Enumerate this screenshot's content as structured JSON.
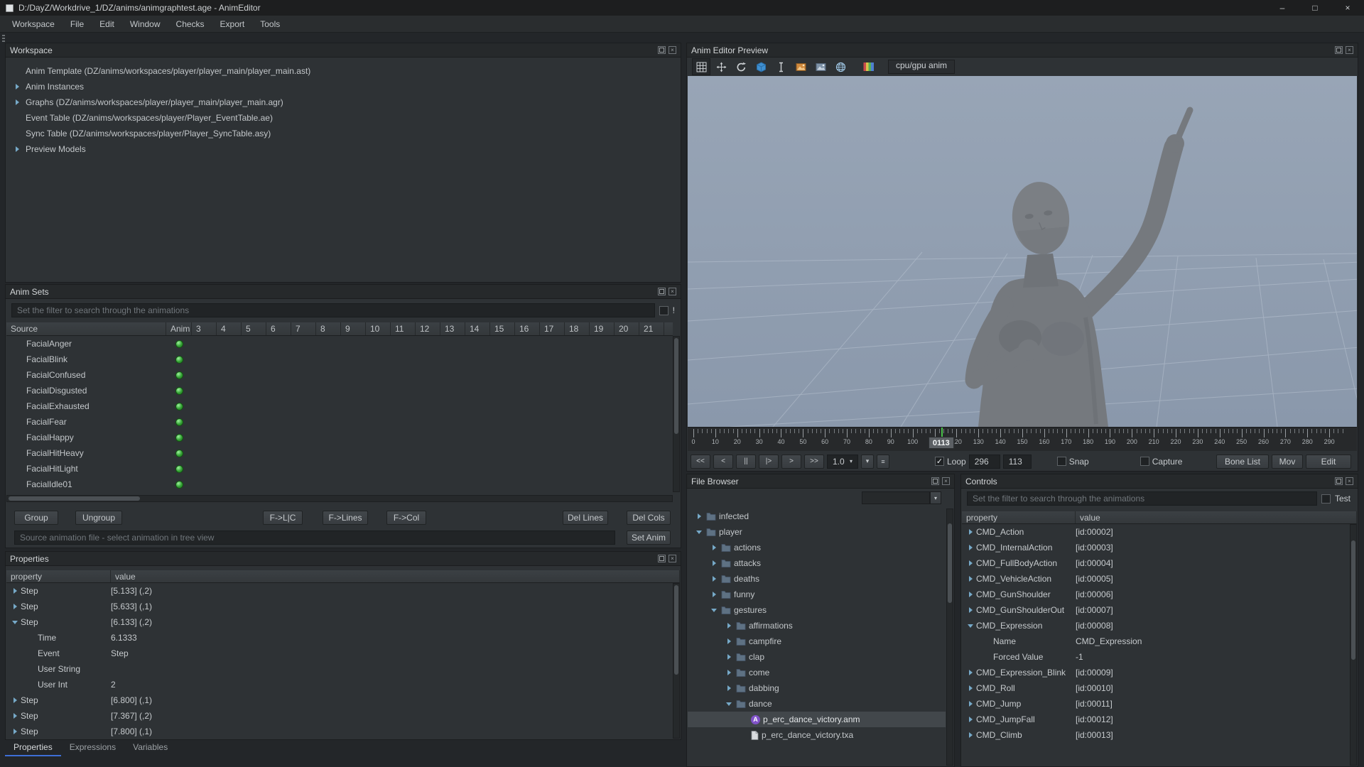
{
  "colors": {
    "accent_green": "#33a033",
    "tab_accent": "#3e6fd6",
    "viewport_top": "#98a5b6",
    "viewport_bottom": "#8a98ab",
    "anm_icon_purple": "#8052c8"
  },
  "window": {
    "title": "D:/DayZ/Workdrive_1/DZ/anims/animgraphtest.age - AnimEditor",
    "controls": {
      "minimize": "–",
      "maximize": "□",
      "close": "×"
    }
  },
  "menu": {
    "items": [
      "Workspace",
      "File",
      "Edit",
      "Window",
      "Checks",
      "Export",
      "Tools"
    ]
  },
  "workspace": {
    "title": "Workspace",
    "items": [
      {
        "label": "Anim Template (DZ/anims/workspaces/player/player_main/player_main.ast)",
        "arrow": ""
      },
      {
        "label": "Anim Instances",
        "arrow": "collapsed"
      },
      {
        "label": "Graphs (DZ/anims/workspaces/player/player_main/player_main.agr)",
        "arrow": "collapsed"
      },
      {
        "label": "Event Table (DZ/anims/workspaces/player/Player_EventTable.ae)",
        "arrow": ""
      },
      {
        "label": "Sync Table (DZ/anims/workspaces/player/Player_SyncTable.asy)",
        "arrow": ""
      },
      {
        "label": "Preview Models",
        "arrow": "collapsed"
      }
    ]
  },
  "anim_sets": {
    "title": "Anim Sets",
    "filter_placeholder": "Set the filter to search through the animations",
    "filter_negate_label": "!",
    "columns": [
      "Source",
      "Anim",
      "3",
      "4",
      "5",
      "6",
      "7",
      "8",
      "9",
      "10",
      "11",
      "12",
      "13",
      "14",
      "15",
      "16",
      "17",
      "18",
      "19",
      "20",
      "21"
    ],
    "rows": [
      "FacialAnger",
      "FacialBlink",
      "FacialConfused",
      "FacialDisgusted",
      "FacialExhausted",
      "FacialFear",
      "FacialHappy",
      "FacialHitHeavy",
      "FacialHitLight",
      "FacialIdle01"
    ],
    "buttons_left": [
      "Group",
      "Ungroup"
    ],
    "buttons_center": [
      "F->L|C",
      "F->Lines",
      "F->Col"
    ],
    "buttons_right": [
      "Del Lines",
      "Del Cols"
    ],
    "status_text": "Source animation file - select animation in tree view",
    "set_anim_label": "Set Anim"
  },
  "properties": {
    "title": "Properties",
    "col_property": "property",
    "col_value": "value",
    "rows": [
      {
        "arrow": "c",
        "sub": false,
        "name": "Step",
        "value": "[5.133] (,2)"
      },
      {
        "arrow": "c",
        "sub": false,
        "name": "Step",
        "value": "[5.633] (,1)"
      },
      {
        "arrow": "e",
        "sub": false,
        "name": "Step",
        "value": "[6.133] (,2)"
      },
      {
        "arrow": "",
        "sub": true,
        "name": "Time",
        "value": "6.1333"
      },
      {
        "arrow": "",
        "sub": true,
        "name": "Event",
        "value": "Step"
      },
      {
        "arrow": "",
        "sub": true,
        "name": "User String",
        "value": ""
      },
      {
        "arrow": "",
        "sub": true,
        "name": "User Int",
        "value": "2"
      },
      {
        "arrow": "c",
        "sub": false,
        "name": "Step",
        "value": "[6.800] (,1)"
      },
      {
        "arrow": "c",
        "sub": false,
        "name": "Step",
        "value": "[7.367] (,2)"
      },
      {
        "arrow": "c",
        "sub": false,
        "name": "Step",
        "value": "[7.800] (,1)"
      }
    ],
    "tabs": [
      "Properties",
      "Expressions",
      "Variables"
    ],
    "active_tab": 0
  },
  "preview": {
    "title": "Anim Editor Preview",
    "mode_button": "cpu/gpu anim",
    "toolbar_icons": [
      "grid-icon",
      "move-icon",
      "rotate-icon",
      "cube-icon",
      "ibeam-icon",
      "image-orange-icon",
      "image-blue-icon",
      "globe-icon",
      "colorbar-icon"
    ],
    "timeline": {
      "labels": [
        0,
        10,
        20,
        30,
        40,
        50,
        60,
        70,
        80,
        90,
        100,
        110,
        120,
        130,
        140,
        150,
        160,
        170,
        180,
        190,
        200,
        210,
        220,
        230,
        240,
        250,
        260,
        270,
        280,
        290
      ],
      "max_frame": 296,
      "playhead_frame": 113,
      "current_frame_label": "0113"
    },
    "playback": {
      "transport": [
        "<<",
        "<",
        "||",
        "|>",
        ">",
        ">>"
      ],
      "speed": "1.0",
      "speed_dropdown_glyph": "▾",
      "speed_menu_glyph": "≡",
      "loop_label": "Loop",
      "loop_checked": true,
      "total_frames": "296",
      "current_frame": "113",
      "snap_label": "Snap",
      "snap_checked": false,
      "capture_label": "Capture",
      "capture_checked": false,
      "bone_list_label": "Bone List",
      "mov_label": "Mov",
      "edit_label": "Edit"
    }
  },
  "file_browser": {
    "title": "File Browser",
    "dropdown_glyph": "▾",
    "tree": [
      {
        "indent": 1,
        "arrow": "c",
        "type": "folder",
        "label": "infected",
        "selected": false
      },
      {
        "indent": 1,
        "arrow": "e",
        "type": "folder",
        "label": "player",
        "selected": false
      },
      {
        "indent": 2,
        "arrow": "c",
        "type": "folder",
        "label": "actions",
        "selected": false
      },
      {
        "indent": 2,
        "arrow": "c",
        "type": "folder",
        "label": "attacks",
        "selected": false
      },
      {
        "indent": 2,
        "arrow": "c",
        "type": "folder",
        "label": "deaths",
        "selected": false
      },
      {
        "indent": 2,
        "arrow": "c",
        "type": "folder",
        "label": "funny",
        "selected": false
      },
      {
        "indent": 2,
        "arrow": "e",
        "type": "folder",
        "label": "gestures",
        "selected": false
      },
      {
        "indent": 3,
        "arrow": "c",
        "type": "folder",
        "label": "affirmations",
        "selected": false
      },
      {
        "indent": 3,
        "arrow": "c",
        "type": "folder",
        "label": "campfire",
        "selected": false
      },
      {
        "indent": 3,
        "arrow": "c",
        "type": "folder",
        "label": "clap",
        "selected": false
      },
      {
        "indent": 3,
        "arrow": "c",
        "type": "folder",
        "label": "come",
        "selected": false
      },
      {
        "indent": 3,
        "arrow": "c",
        "type": "folder",
        "label": "dabbing",
        "selected": false
      },
      {
        "indent": 3,
        "arrow": "e",
        "type": "folder",
        "label": "dance",
        "selected": false
      },
      {
        "indent": 4,
        "arrow": "",
        "type": "anm",
        "label": "p_erc_dance_victory.anm",
        "selected": true
      },
      {
        "indent": 4,
        "arrow": "",
        "type": "txa",
        "label": "p_erc_dance_victory.txa",
        "selected": false
      }
    ]
  },
  "controls": {
    "title": "Controls",
    "filter_placeholder": "Set the filter to search through the animations",
    "test_label": "Test",
    "col_property": "property",
    "col_value": "value",
    "rows": [
      {
        "arrow": "c",
        "sub": false,
        "name": "CMD_Action",
        "value": "[id:00002]"
      },
      {
        "arrow": "c",
        "sub": false,
        "name": "CMD_InternalAction",
        "value": "[id:00003]"
      },
      {
        "arrow": "c",
        "sub": false,
        "name": "CMD_FullBodyAction",
        "value": "[id:00004]"
      },
      {
        "arrow": "c",
        "sub": false,
        "name": "CMD_VehicleAction",
        "value": "[id:00005]"
      },
      {
        "arrow": "c",
        "sub": false,
        "name": "CMD_GunShoulder",
        "value": "[id:00006]"
      },
      {
        "arrow": "c",
        "sub": false,
        "name": "CMD_GunShoulderOut",
        "value": "[id:00007]"
      },
      {
        "arrow": "e",
        "sub": false,
        "name": "CMD_Expression",
        "value": "[id:00008]"
      },
      {
        "arrow": "",
        "sub": true,
        "name": "Name",
        "value": "CMD_Expression"
      },
      {
        "arrow": "",
        "sub": true,
        "name": "Forced Value",
        "value": "-1"
      },
      {
        "arrow": "c",
        "sub": false,
        "name": "CMD_Expression_Blink",
        "value": "[id:00009]"
      },
      {
        "arrow": "c",
        "sub": false,
        "name": "CMD_Roll",
        "value": "[id:00010]"
      },
      {
        "arrow": "c",
        "sub": false,
        "name": "CMD_Jump",
        "value": "[id:00011]"
      },
      {
        "arrow": "c",
        "sub": false,
        "name": "CMD_JumpFall",
        "value": "[id:00012]"
      },
      {
        "arrow": "c",
        "sub": false,
        "name": "CMD_Climb",
        "value": "[id:00013]"
      }
    ]
  }
}
